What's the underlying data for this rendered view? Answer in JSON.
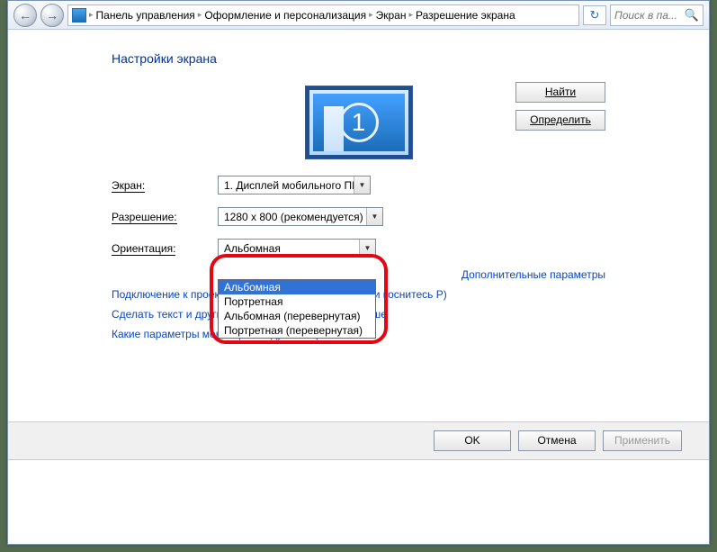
{
  "nav": {
    "back_glyph": "←",
    "fwd_glyph": "→",
    "refresh_glyph": "↻",
    "search_placeholder": "Поиск в па...",
    "search_glyph": "🔍"
  },
  "breadcrumb": {
    "sep": "▸",
    "items": [
      "Панель управления",
      "Оформление и персонализация",
      "Экран",
      "Разрешение экрана"
    ]
  },
  "page": {
    "title": "Настройки экрана",
    "monitor_num": "1"
  },
  "side_buttons": {
    "find": "Найти",
    "detect": "Определить"
  },
  "labels": {
    "display": "Экран:",
    "resolution": "Разрешение:",
    "orientation": "Ориентация:"
  },
  "values": {
    "display": "1. Дисплей мобильного ПК",
    "resolution": "1280 x 800 (рекомендуется)",
    "orientation": "Альбомная"
  },
  "orientation_options": [
    "Альбомная",
    "Портретная",
    "Альбомная (перевернутая)",
    "Портретная (перевернутая)"
  ],
  "links": {
    "advanced": "Дополнительные параметры",
    "projector": "Подключение к проектору (или нажмите клавишу ⊞ и коснитесь P)",
    "text_size": "Сделать текст и другие элементы больше или меньше",
    "which_settings": "Какие параметры монитора следует выбрать?"
  },
  "footer": {
    "ok": "OK",
    "cancel": "Отмена",
    "apply": "Применить"
  }
}
